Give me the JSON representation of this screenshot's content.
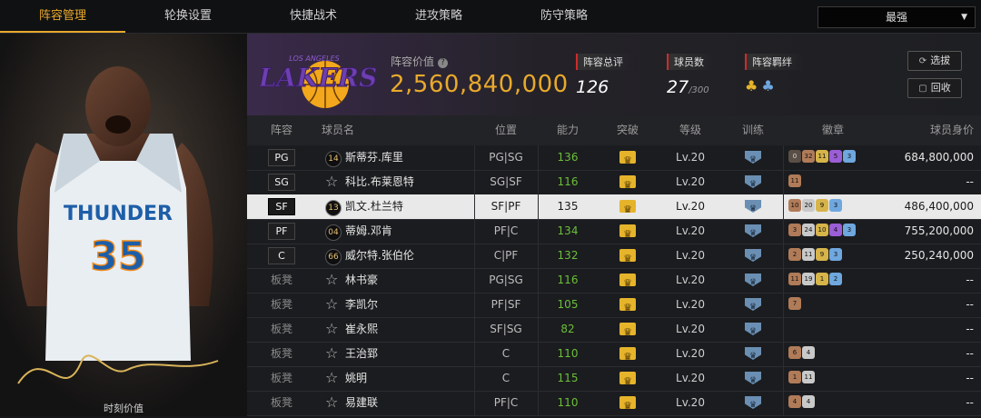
{
  "nav": {
    "tabs": [
      {
        "label": "阵容管理",
        "active": true
      },
      {
        "label": "轮换设置",
        "active": false
      },
      {
        "label": "快捷战术",
        "active": false
      },
      {
        "label": "进攻策略",
        "active": false
      },
      {
        "label": "防守策略",
        "active": false
      }
    ],
    "dropdown": {
      "selected": "最强"
    }
  },
  "portrait": {
    "label": "时刻价值",
    "jersey_text": "THUNDER",
    "jersey_number": "35"
  },
  "team": {
    "logo_text": "LAKERS",
    "logo_subtext": "LOS ANGELES",
    "lineup_value_label": "阵容价值",
    "lineup_value": "2,560,840,000",
    "rating_label": "阵容总评",
    "rating": "126",
    "player_count_label": "球员数",
    "player_count": "27",
    "player_count_max": "/300",
    "bond_label": "阵容羁绊"
  },
  "buttons": {
    "scout": "选拔",
    "recycle": "回收"
  },
  "colors": {
    "accent": "#e8a92c",
    "green": "#6bbf3a",
    "selected_row": "#e9e9e9"
  },
  "table": {
    "headers": [
      "阵容",
      "球员名",
      "位置",
      "能力",
      "突破",
      "等级",
      "训练",
      "徽章",
      "球员身价"
    ],
    "rows": [
      {
        "slot": "PG",
        "jersey": "14",
        "name": "斯蒂芬.库里",
        "position": "PG|SG",
        "ability": "136",
        "ability_green": true,
        "level": "Lv.20",
        "badges": [
          [
            "b-dark",
            "0"
          ],
          [
            "b-bronze",
            "32"
          ],
          [
            "b-gold",
            "11"
          ],
          [
            "b-purple",
            "5"
          ],
          [
            "b-blue",
            "3"
          ]
        ],
        "value": "684,800,000"
      },
      {
        "slot": "SG",
        "jersey": "",
        "name": "科比.布莱恩特",
        "position": "SG|SF",
        "ability": "116",
        "ability_green": true,
        "level": "Lv.20",
        "badges": [
          [
            "b-bronze",
            "11"
          ]
        ],
        "value": "--"
      },
      {
        "slot": "SF",
        "jersey": "13",
        "name": "凯文.杜兰特",
        "position": "SF|PF",
        "ability": "135",
        "ability_green": false,
        "level": "Lv.20",
        "badges": [
          [
            "b-bronze",
            "10"
          ],
          [
            "b-silver",
            "20"
          ],
          [
            "b-gold",
            "9"
          ],
          [
            "b-blue",
            "3"
          ]
        ],
        "value": "486,400,000",
        "selected": true
      },
      {
        "slot": "PF",
        "jersey": "04",
        "name": "蒂姆.邓肯",
        "position": "PF|C",
        "ability": "134",
        "ability_green": true,
        "level": "Lv.20",
        "badges": [
          [
            "b-bronze",
            "3"
          ],
          [
            "b-silver",
            "24"
          ],
          [
            "b-gold",
            "10"
          ],
          [
            "b-purple",
            "4"
          ],
          [
            "b-blue",
            "3"
          ]
        ],
        "value": "755,200,000"
      },
      {
        "slot": "C",
        "jersey": "66",
        "name": "威尔特.张伯伦",
        "position": "C|PF",
        "ability": "132",
        "ability_green": true,
        "level": "Lv.20",
        "badges": [
          [
            "b-bronze",
            "2"
          ],
          [
            "b-silver",
            "11"
          ],
          [
            "b-gold",
            "9"
          ],
          [
            "b-blue",
            "3"
          ]
        ],
        "value": "250,240,000"
      },
      {
        "slot": "板凳",
        "jersey": "",
        "name": "林书豪",
        "position": "PG|SG",
        "ability": "116",
        "ability_green": true,
        "level": "Lv.20",
        "badges": [
          [
            "b-bronze",
            "11"
          ],
          [
            "b-silver",
            "19"
          ],
          [
            "b-gold",
            "1"
          ],
          [
            "b-blue",
            "2"
          ]
        ],
        "value": "--"
      },
      {
        "slot": "板凳",
        "jersey": "",
        "name": "李凯尔",
        "position": "PF|SF",
        "ability": "105",
        "ability_green": true,
        "level": "Lv.20",
        "badges": [
          [
            "b-bronze",
            "7"
          ]
        ],
        "value": "--"
      },
      {
        "slot": "板凳",
        "jersey": "",
        "name": "崔永熙",
        "position": "SF|SG",
        "ability": "82",
        "ability_green": true,
        "level": "Lv.20",
        "badges": [],
        "value": "--"
      },
      {
        "slot": "板凳",
        "jersey": "",
        "name": "王治郅",
        "position": "C",
        "ability": "110",
        "ability_green": true,
        "level": "Lv.20",
        "badges": [
          [
            "b-bronze",
            "6"
          ],
          [
            "b-silver",
            "4"
          ]
        ],
        "value": "--"
      },
      {
        "slot": "板凳",
        "jersey": "",
        "name": "姚明",
        "position": "C",
        "ability": "115",
        "ability_green": true,
        "level": "Lv.20",
        "badges": [
          [
            "b-bronze",
            "1"
          ],
          [
            "b-silver",
            "11"
          ]
        ],
        "value": "--"
      },
      {
        "slot": "板凳",
        "jersey": "",
        "name": "易建联",
        "position": "PF|C",
        "ability": "110",
        "ability_green": true,
        "level": "Lv.20",
        "badges": [
          [
            "b-bronze",
            "4"
          ],
          [
            "b-silver",
            "4"
          ]
        ],
        "value": "--"
      }
    ]
  }
}
